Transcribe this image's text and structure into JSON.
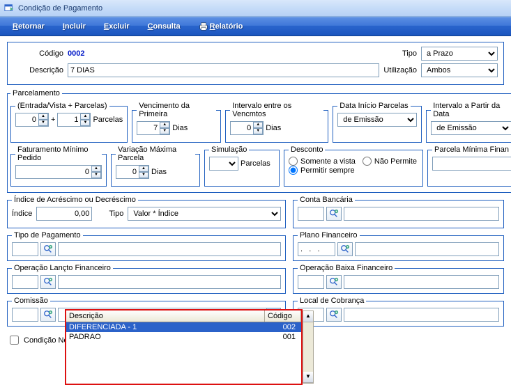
{
  "window": {
    "title": "Condição de Pagamento"
  },
  "toolbar": {
    "retornar": "Retornar",
    "incluir": "Incluir",
    "excluir": "Excluir",
    "consulta": "Consulta",
    "relatorio": "Relatório"
  },
  "header": {
    "codigo_label": "Código",
    "codigo": "0002",
    "tipo_label": "Tipo",
    "tipo": "a Prazo",
    "descricao_label": "Descrição",
    "descricao": "7 DIAS",
    "utilizacao_label": "Utilização",
    "utilizacao": "Ambos"
  },
  "parcelamento": {
    "legend": "Parcelamento",
    "entrada_legend": "(Entrada/Vista + Parcelas)",
    "entrada": "0",
    "plus": "+",
    "parcelas": "1",
    "parcelas_label": "Parcelas",
    "venc_legend": "Vencimento da Primeira",
    "venc_dias": "7",
    "dias_label": "Dias",
    "intervalo_legend": "Intervalo entre os Vencmtos",
    "intervalo": "0",
    "data_inicio_legend": "Data Início Parcelas",
    "data_inicio": "de Emissão",
    "intervalo_partir_legend": "Intervalo a Partir da Data",
    "intervalo_partir": "de Emissão",
    "fat_min_legend": "Faturamento Mínimo Pedido",
    "fat_min": "0",
    "var_max_legend": "Variação Máxima Parcela",
    "var_max": "0",
    "simulacao_legend": "Simulação",
    "simulacao_sufixo": "Parcelas",
    "desconto_legend": "Desconto",
    "desconto_somente": "Somente a vista",
    "desconto_nao": "Não Permite",
    "desconto_permitir": "Permitir sempre",
    "parcela_min_legend": "Parcela Mínima Finan"
  },
  "indice": {
    "legend": "Índice de Acréscimo ou Decréscimo",
    "indice_label": "Índice",
    "indice_valor": "0,00",
    "tipo_label": "Tipo",
    "tipo_valor": "Valor * Índice"
  },
  "conta_bancaria": {
    "legend": "Conta Bancária"
  },
  "tipo_pagamento": {
    "legend": "Tipo de Pagamento"
  },
  "plano_financeiro": {
    "legend": "Plano Financeiro",
    "mask": ".   .   ."
  },
  "op_lancto": {
    "legend": "Operação Lançto Financeiro"
  },
  "op_baixa": {
    "legend": "Operação Baixa Financeiro"
  },
  "comissao": {
    "legend": "Comissão"
  },
  "local_cobranca": {
    "legend": "Local de Cobrança"
  },
  "condicao_ne": "Condição Ne",
  "dropdown": {
    "col_desc": "Descrição",
    "col_cod": "Código",
    "items": [
      {
        "desc": "DIFERENCIADA - 1",
        "cod": "002",
        "selected": true
      },
      {
        "desc": "PADRAO",
        "cod": "001",
        "selected": false
      }
    ]
  }
}
